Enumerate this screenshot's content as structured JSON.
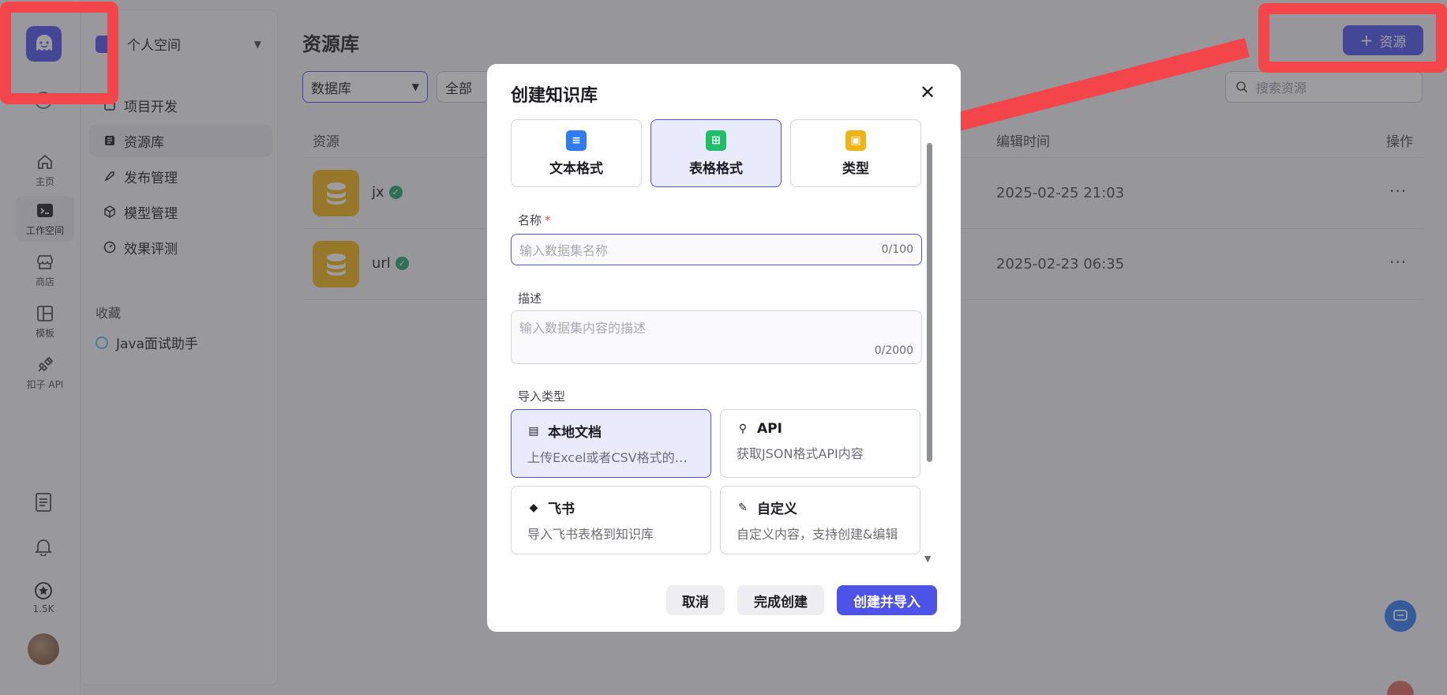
{
  "rail": {
    "items": [
      {
        "label": "主页",
        "icon": "home-icon"
      },
      {
        "label": "工作空间",
        "icon": "terminal-icon"
      },
      {
        "label": "商店",
        "icon": "store-icon"
      },
      {
        "label": "模板",
        "icon": "template-icon"
      },
      {
        "label": "扣子 API",
        "icon": "plug-icon"
      }
    ],
    "star_count": "1.5K"
  },
  "sidebar": {
    "space_name": "个人空间",
    "nav": [
      {
        "label": "项目开发",
        "icon": "project-icon"
      },
      {
        "label": "资源库",
        "icon": "library-icon"
      },
      {
        "label": "发布管理",
        "icon": "rocket-icon"
      },
      {
        "label": "模型管理",
        "icon": "cube-icon"
      },
      {
        "label": "效果评测",
        "icon": "gauge-icon"
      }
    ],
    "favorites_title": "收藏",
    "favorites": [
      {
        "label": "Java面试助手"
      }
    ]
  },
  "main": {
    "title": "资源库",
    "add_button": "资源",
    "filters": [
      {
        "value": "数据库"
      },
      {
        "value": "全部"
      }
    ],
    "search_placeholder": "搜索资源",
    "columns": {
      "resource": "资源",
      "edit_time": "编辑时间",
      "action": "操作"
    },
    "rows": [
      {
        "name": "jx",
        "time": "2025-02-25 21:03"
      },
      {
        "name": "url",
        "time": "2025-02-23 06:35"
      }
    ]
  },
  "modal": {
    "title": "创建知识库",
    "formats": [
      {
        "label": "文本格式",
        "color": "#2f7bf5"
      },
      {
        "label": "表格格式",
        "color": "#1fbf6a"
      },
      {
        "label": "类型",
        "color": "#f2b413"
      }
    ],
    "name_label": "名称",
    "name_placeholder": "输入数据集名称",
    "name_count": "0/100",
    "desc_label": "描述",
    "desc_placeholder": "输入数据集内容的描述",
    "desc_count": "0/2000",
    "import_label": "导入类型",
    "import_types": [
      {
        "title": "本地文档",
        "desc": "上传Excel或者CSV格式的文档"
      },
      {
        "title": "API",
        "desc": "获取JSON格式API内容"
      },
      {
        "title": "飞书",
        "desc": "导入飞书表格到知识库"
      },
      {
        "title": "自定义",
        "desc": "自定义内容，支持创建&编辑"
      }
    ],
    "buttons": {
      "cancel": "取消",
      "finish": "完成创建",
      "create_import": "创建并导入"
    }
  },
  "colors": {
    "accent": "#4d53e8",
    "annotation": "#f4454a"
  }
}
